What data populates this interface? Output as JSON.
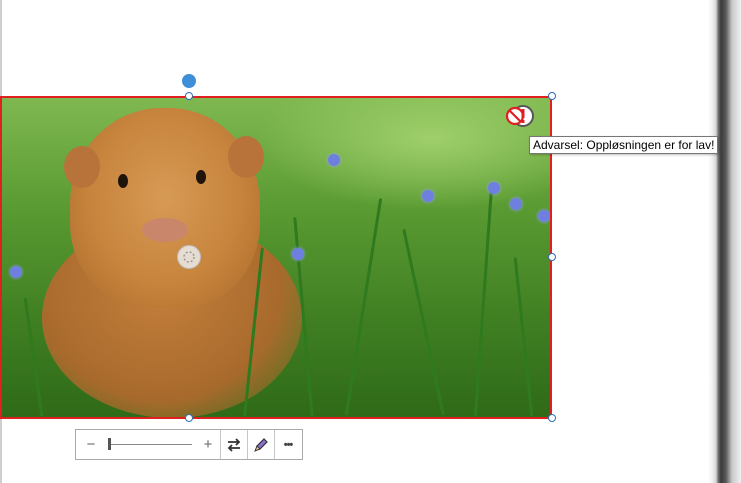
{
  "warning": {
    "tooltip_text": "Advarsel: Oppløsningen er for lav!",
    "icon": "low-resolution-warning-icon",
    "color": "#e02020"
  },
  "picture": {
    "subject": "guinea pig in grass",
    "selection_color": "#e02020",
    "handle_color": "#2f6fb6",
    "rotate_handle_color": "#3e8fd8"
  },
  "toolbar": {
    "zoom_out_label": "−",
    "zoom_in_label": "+",
    "zoom_level": 0,
    "swap_icon": "swap-arrows-icon",
    "edit_icon": "pencil-icon",
    "more_label": "•••"
  }
}
